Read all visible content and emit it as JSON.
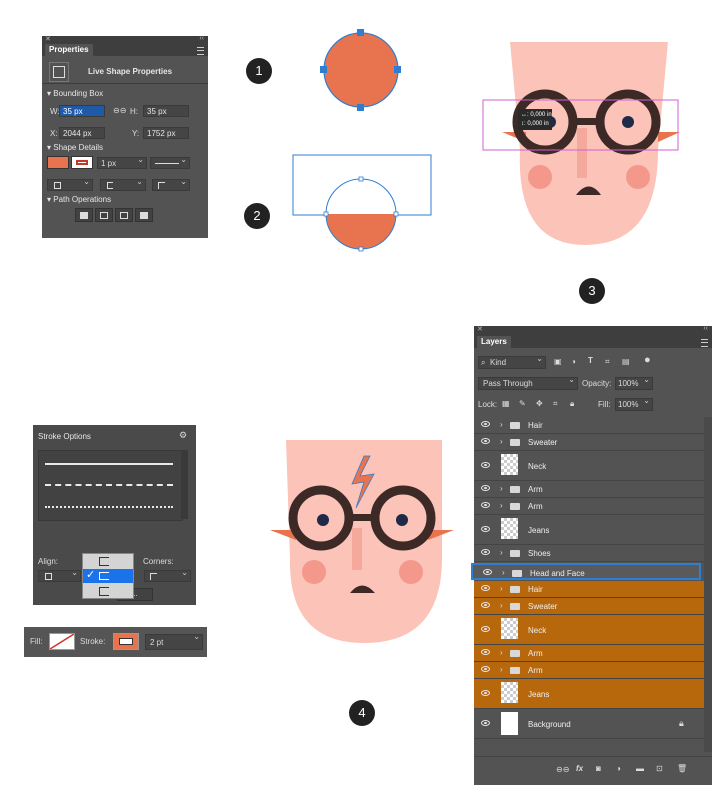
{
  "steps": [
    "1",
    "2",
    "3",
    "4"
  ],
  "properties": {
    "tab": "Properties",
    "title": "Live Shape Properties",
    "bounding_box": "Bounding Box",
    "w_label": "W:",
    "w_value": "35 px",
    "h_label": "H:",
    "h_value": "35 px",
    "x_label": "X:",
    "x_value": "2044 px",
    "y_label": "Y:",
    "y_value": "1752 px",
    "shape_details": "Shape Details",
    "stroke_width": "1 px",
    "path_operations": "Path Operations",
    "fill_color": "#e8734f"
  },
  "tooltip": {
    "line1": "↔: 0,000 in",
    "line2": "↕: 0,000 in"
  },
  "stroke_options": {
    "title": "Stroke Options",
    "align_label": "Align:",
    "corners_label": "Corners:",
    "more_label": "..."
  },
  "options_bar": {
    "fill_label": "Fill:",
    "stroke_label": "Stroke:",
    "stroke_value": "2 pt"
  },
  "layers": {
    "tab": "Layers",
    "kind": "Kind",
    "blend_mode": "Pass Through",
    "opacity_label": "Opacity:",
    "opacity_value": "100%",
    "lock_label": "Lock:",
    "fill_label": "Fill:",
    "fill_value": "100%",
    "rows": [
      {
        "name": "Hair",
        "type": "folder",
        "orange": false
      },
      {
        "name": "Sweater",
        "type": "folder",
        "orange": false
      },
      {
        "name": "Neck",
        "type": "smart",
        "orange": false
      },
      {
        "name": "Arm",
        "type": "folder",
        "orange": false
      },
      {
        "name": "Arm",
        "type": "folder",
        "orange": false
      },
      {
        "name": "Jeans",
        "type": "smart",
        "orange": false
      },
      {
        "name": "Shoes",
        "type": "folder",
        "orange": false
      },
      {
        "name": "Head and Face",
        "type": "folder",
        "orange": false,
        "selected": true
      },
      {
        "name": "Hair",
        "type": "folder",
        "orange": true
      },
      {
        "name": "Sweater",
        "type": "folder",
        "orange": true
      },
      {
        "name": "Neck",
        "type": "smart",
        "orange": true
      },
      {
        "name": "Arm",
        "type": "folder",
        "orange": true
      },
      {
        "name": "Arm",
        "type": "folder",
        "orange": true
      },
      {
        "name": "Jeans",
        "type": "smart",
        "orange": true
      },
      {
        "name": "Background",
        "type": "background",
        "orange": false
      }
    ]
  },
  "colors": {
    "skin": "#fcc3b8",
    "cheek": "#f5988c",
    "orange": "#e8734f",
    "glasses": "#3d2a27",
    "eye": "#1e2a48",
    "selection": "#2f7ed0",
    "panel": "#535353"
  }
}
